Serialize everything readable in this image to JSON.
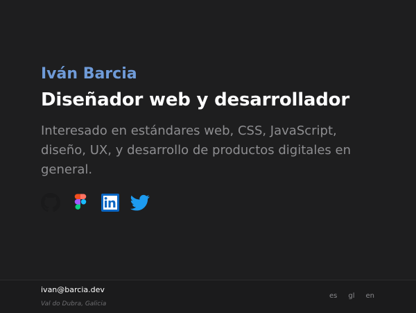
{
  "hero": {
    "name": "Iván Barcia",
    "role": "Diseñador web y desarrollador",
    "intro": "Interesado en estándares web, CSS, JavaScript, diseño, UX, y desarrollo de productos digitales en general."
  },
  "social": [
    {
      "name": "github",
      "icon": "github-icon"
    },
    {
      "name": "figma",
      "icon": "figma-icon"
    },
    {
      "name": "linkedin",
      "icon": "linkedin-icon"
    },
    {
      "name": "twitter",
      "icon": "twitter-icon"
    }
  ],
  "footer": {
    "email": "ivan@barcia.dev",
    "location": "Val do Dubra, Galicia",
    "languages": [
      "es",
      "gl",
      "en"
    ]
  },
  "colors": {
    "background": "#1e1e1f",
    "accent": "#6f9bd8",
    "heading": "#ffffff",
    "body_text": "#8e8e91",
    "linkedin": "#0a66c2",
    "twitter": "#1d9bf0"
  }
}
